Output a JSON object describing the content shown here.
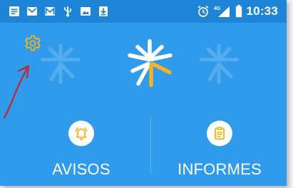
{
  "status_bar": {
    "time": "10:33",
    "network": "4G",
    "notification_icons": [
      "message-icon",
      "gmail-icon",
      "gmail-icon",
      "usb-icon",
      "image-icon",
      "download-icon"
    ]
  },
  "header": {
    "settings_icon": "gear-icon",
    "logo": "sun-logo"
  },
  "actions": {
    "avisos": {
      "label": "AVISOS",
      "icon": "alarm-bell-icon"
    },
    "informes": {
      "label": "INFORMES",
      "icon": "clipboard-icon"
    }
  },
  "colors": {
    "background": "#2f9bea",
    "status_bar": "#1e85d6",
    "accent": "#f6b21f",
    "annotation": "#c0282d"
  }
}
